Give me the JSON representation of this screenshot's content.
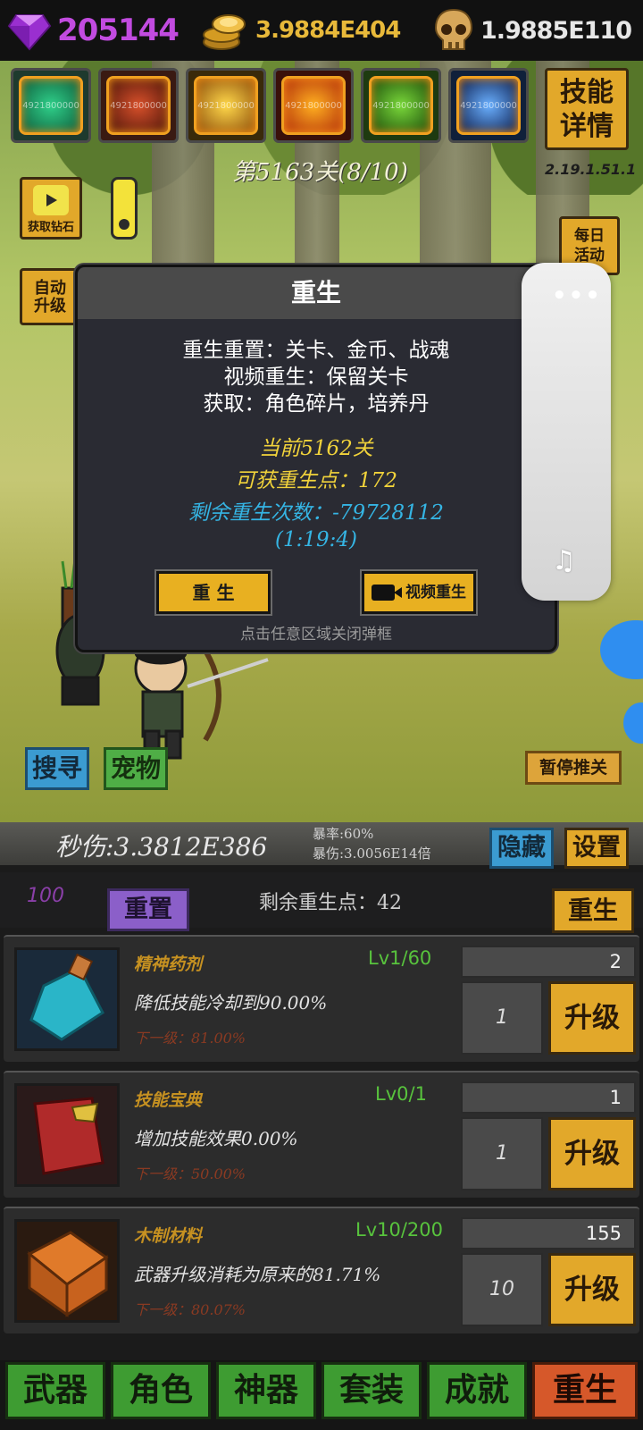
{
  "resources": {
    "gems": "205144",
    "gold": "3.9884E404",
    "souls": "1.9885E110"
  },
  "skills": {
    "items": [
      {
        "icon": "green-whirl-skill-icon",
        "label": "4921800000"
      },
      {
        "icon": "red-slash-skill-icon",
        "label": "4921800000"
      },
      {
        "icon": "golden-star-skill-icon",
        "label": "4921800000"
      },
      {
        "icon": "fire-blast-skill-icon",
        "label": "4921800000"
      },
      {
        "icon": "arrow-shot-skill-icon",
        "label": "4921800000"
      },
      {
        "icon": "lightning-skill-icon",
        "label": "4921800000"
      }
    ],
    "detail_label": "技能\n详情"
  },
  "scene": {
    "stage": "第5163关(8/10)",
    "version": "2.19.1.51.1",
    "video_gem_label": "获取钻石",
    "auto_upgrade_label": "自动\n升级",
    "daily_label": "每日\n活动",
    "search_label": "搜寻",
    "pet_label": "宠物",
    "pause_label": "暂停推关"
  },
  "dialog": {
    "title": "重生",
    "line1": "重生重置：关卡、金币、战魂",
    "line2": "视频重生：保留关卡",
    "line3": "获取：角色碎片，培养丹",
    "current": "当前5162关",
    "points": "可获重生点：172",
    "remaining": "剩余重生次数：-79728112",
    "timer": "(1:19:4)",
    "rebirth_btn": "重 生",
    "video_btn": "视频重生",
    "hint": "点击任意区域关闭弹框"
  },
  "float_panel": {
    "menu_icon": "more-dots-icon",
    "mute_icon": "music-off-icon"
  },
  "stats": {
    "dps": "秒伤:3.3812E386",
    "crit_rate": "暴率:60%",
    "crit_dmg": "暴伤:3.0056E14倍",
    "hide_label": "隐藏",
    "settings_label": "设置"
  },
  "reset_row": {
    "cost": "100",
    "reset_label": "重置",
    "points_left": "剩余重生点：42",
    "rebirth_label": "重生"
  },
  "upgrades": [
    {
      "name": "精神药剂",
      "level": "Lv1/60",
      "desc": "降低技能冷却到90.00%",
      "next": "下一级：81.00%",
      "cost": "2",
      "qty": "1",
      "btn": "升级",
      "icon": "potion-icon"
    },
    {
      "name": "技能宝典",
      "level": "Lv0/1",
      "desc": "增加技能效果0.00%",
      "next": "下一级：50.00%",
      "cost": "1",
      "qty": "1",
      "btn": "升级",
      "icon": "red-book-icon"
    },
    {
      "name": "木制材料",
      "level": "Lv10/200",
      "desc": "武器升级消耗为原来的81.71%",
      "next": "下一级：80.07%",
      "cost": "155",
      "qty": "10",
      "btn": "升级",
      "icon": "wooden-crate-icon"
    }
  ],
  "tabs": [
    "武器",
    "角色",
    "神器",
    "套装",
    "成就",
    "重生"
  ],
  "colors": {
    "gem": "#c24be0",
    "gold": "#e8b93a",
    "accent_button": "#e2a82a",
    "active_tab": "#d6582a",
    "tab": "#3e9c32",
    "dialog_cyan": "#35b5e4",
    "dialog_yellow": "#f1d33b"
  }
}
